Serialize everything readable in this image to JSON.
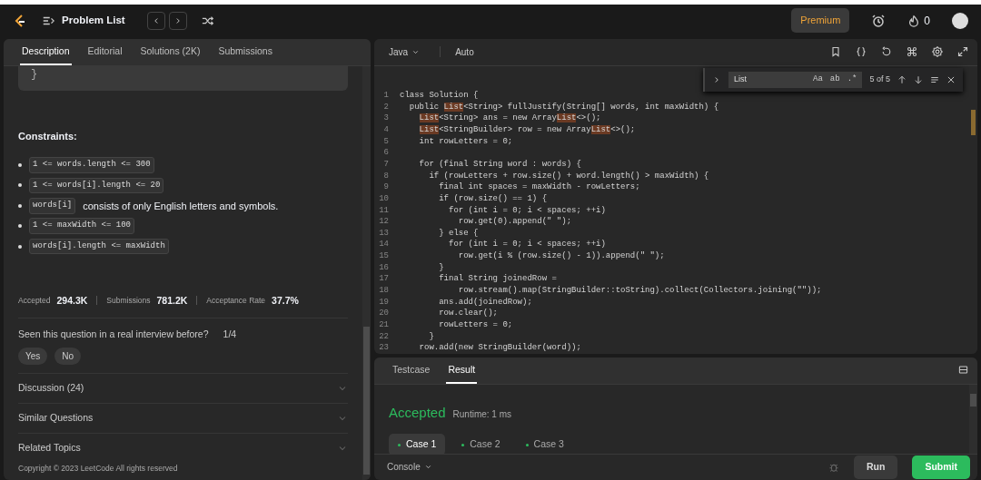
{
  "navbar": {
    "title": "Problem List",
    "premium": "Premium",
    "streak": "0"
  },
  "description": {
    "tabs": [
      {
        "label": "Description",
        "selected": true
      },
      {
        "label": "Editorial",
        "selected": false
      },
      {
        "label": "Solutions (2K)",
        "selected": false
      },
      {
        "label": "Submissions",
        "selected": false
      }
    ],
    "code_tail": "}",
    "constraints_title": "Constraints:",
    "constraints": [
      {
        "code": "1 <= words.length <= 300"
      },
      {
        "code": "1 <= words[i].length <= 20"
      },
      {
        "code": "words[i]",
        "text": "consists of only English letters and symbols."
      },
      {
        "code": "1 <= maxWidth <= 100"
      },
      {
        "code": "words[i].length <= maxWidth"
      }
    ],
    "stats": [
      {
        "label": "Accepted",
        "value": "294.3K"
      },
      {
        "label": "Submissions",
        "value": "781.2K"
      },
      {
        "label": "Acceptance Rate",
        "value": "37.7%"
      }
    ],
    "interview_question": "Seen this question in a real interview before?",
    "interview_count": "1/4",
    "answers": [
      "Yes",
      "No"
    ],
    "sections": [
      {
        "label": "Discussion (24)",
        "expanded": false
      },
      {
        "label": "Similar Questions",
        "expanded": false
      },
      {
        "label": "Related Topics",
        "expanded": false
      }
    ],
    "copyright": "Copyright © 2023 LeetCode All rights reserved"
  },
  "editor": {
    "language": "Java",
    "mode": "Auto",
    "find": {
      "value": "List",
      "options": [
        "Aa",
        "ab",
        ".*"
      ],
      "count": "5 of 5"
    },
    "lines": [
      {
        "number": "1",
        "parts": [
          {
            "text": "class Solution {"
          }
        ]
      },
      {
        "number": "2",
        "parts": [
          {
            "text": "  public "
          },
          {
            "text": "List",
            "match": true
          },
          {
            "text": "<String> fullJustify(String[] words, int maxWidth) {"
          }
        ]
      },
      {
        "number": "3",
        "parts": [
          {
            "text": "    List",
            "match": true
          },
          {
            "text": "<String> ans = new Array"
          },
          {
            "text": "List",
            "match": true
          },
          {
            "text": "<>();"
          }
        ]
      },
      {
        "number": "4",
        "parts": [
          {
            "text": "    List",
            "match": true
          },
          {
            "text": "<StringBuilder> row = new Array"
          },
          {
            "text": "List",
            "match": true
          },
          {
            "text": "<>();"
          }
        ]
      },
      {
        "number": "5",
        "parts": [
          {
            "text": "    int rowLetters = 0;"
          }
        ]
      },
      {
        "number": "6"
      },
      {
        "number": "7",
        "parts": [
          {
            "text": "    for (final String word : words) {"
          }
        ]
      },
      {
        "number": "8",
        "parts": [
          {
            "text": "      if (rowLetters + row.size() + word.length() > maxWidth) {"
          }
        ]
      },
      {
        "number": "9",
        "parts": [
          {
            "text": "        final int spaces = maxWidth - rowLetters;"
          }
        ]
      },
      {
        "number": "10",
        "parts": [
          {
            "text": "        if (row.size() == 1) {"
          }
        ]
      },
      {
        "number": "11",
        "parts": [
          {
            "text": "          for (int i = 0; i < spaces; ++i)"
          }
        ]
      },
      {
        "number": "12",
        "parts": [
          {
            "text": "            row.get(0).append(\" \");"
          }
        ]
      },
      {
        "number": "13",
        "parts": [
          {
            "text": "        } else {"
          }
        ]
      },
      {
        "number": "14",
        "parts": [
          {
            "text": "          for (int i = 0; i < spaces; ++i)"
          }
        ]
      },
      {
        "number": "15",
        "parts": [
          {
            "text": "            row.get(i % (row.size() - 1)).append(\" \");"
          }
        ]
      },
      {
        "number": "16",
        "parts": [
          {
            "text": "        }"
          }
        ]
      },
      {
        "number": "17",
        "parts": [
          {
            "text": "        final String joinedRow ="
          }
        ]
      },
      {
        "number": "18",
        "parts": [
          {
            "text": "            row.stream().map(StringBuilder::toString).collect(Collectors.joining(\"\"));"
          }
        ]
      },
      {
        "number": "19",
        "parts": [
          {
            "text": "        ans.add(joinedRow);"
          }
        ]
      },
      {
        "number": "20",
        "parts": [
          {
            "text": "        row.clear();"
          }
        ]
      },
      {
        "number": "21",
        "parts": [
          {
            "text": "        rowLetters = 0;"
          }
        ]
      },
      {
        "number": "22",
        "parts": [
          {
            "text": "      }"
          }
        ]
      },
      {
        "number": "23",
        "parts": [
          {
            "text": "    row.add(new StringBuilder(word));"
          }
        ]
      }
    ]
  },
  "result": {
    "tabs": [
      {
        "label": "Testcase",
        "selected": false
      },
      {
        "label": "Result",
        "selected": true
      }
    ],
    "status": "Accepted",
    "runtime": "Runtime: 1 ms",
    "cases": [
      {
        "label": "Case 1",
        "selected": true
      },
      {
        "label": "Case 2",
        "selected": false
      },
      {
        "label": "Case 3",
        "selected": false
      }
    ],
    "console": "Console",
    "run": "Run",
    "submit": "Submit"
  }
}
